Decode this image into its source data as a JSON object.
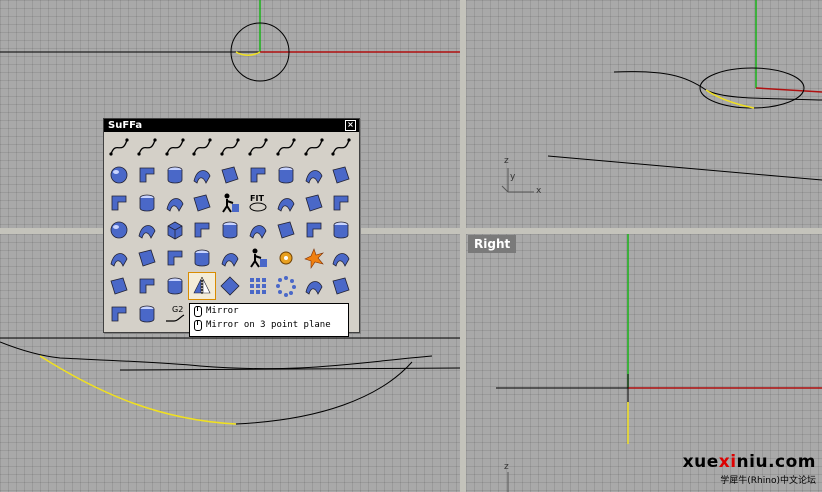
{
  "viewports": {
    "right": {
      "label": "Right"
    },
    "perspective": {
      "axis_z": "z",
      "axis_y": "y",
      "axis_x": "x"
    },
    "bottom_right": {
      "axis_z": "z"
    }
  },
  "toolbar": {
    "title": "SuFFa",
    "close": "×",
    "buttons": [
      [
        "curve-points-icon",
        "curve-blend-icon",
        "curve-sweep-icon",
        "curve-offset-icon",
        "worker-icon",
        "fit-label-icon",
        "curve-arc-icon",
        "curve-tangent-icon",
        "curve-line-icon"
      ],
      [
        "sphere-icon",
        "cylinder-surface-icon",
        "surface-sweep-icon",
        "surface-loft-icon",
        "surface-patch-icon",
        "surface-blend-icon",
        "surface-match-icon",
        "surface-curvature-icon",
        "surface-fold-icon"
      ],
      [
        "surface-wave-icon",
        "surface-twist-icon",
        "surface-network-icon",
        "surface-edge-icon",
        "worker-fit-icon",
        "fit-label-icon-2",
        "cylinder-fit-icon",
        "control-points-icon",
        "surface-control-icon"
      ],
      [
        "solid-sphere-icon",
        "solid-wedge-icon",
        "solid-box-icon",
        "boolean-union-icon",
        "boolean-diff-icon",
        "boolean-split-icon",
        "solid-cylinder-icon",
        "solid-ring-icon",
        "surface-plane-icon"
      ],
      [
        "surface-offset-icon",
        "extrude-icon",
        "surface-flip-icon",
        "surface-split-icon",
        "project-icon",
        "worker-split-icon",
        "gear-icon",
        "explode-icon",
        "surface-join-icon"
      ],
      [
        "panel-icon",
        "trim-icon",
        "curve-rebuild-icon",
        "mirror-icon",
        "diamond-icon",
        "array-icon",
        "polar-array-icon",
        "mirror-double-icon",
        "bend-icon"
      ],
      [
        "flow-icon",
        "stretch-icon",
        "continuity-g2-icon"
      ]
    ]
  },
  "tooltip": {
    "line1": "Mirror",
    "line2": "Mirror on 3 point plane"
  },
  "watermark": {
    "part1": "xue",
    "part2": "xi",
    "part3": "niu.com",
    "subtitle": "学犀牛(Rhino)中文论坛"
  },
  "colors": {
    "viewport_bg": "#a9a9a9",
    "axis_red": "#b01010",
    "axis_green": "#19b219",
    "selection_yellow": "#f0e020",
    "toolbar_bg": "#d4d0c8",
    "icon_blue": "#4a68c8"
  }
}
